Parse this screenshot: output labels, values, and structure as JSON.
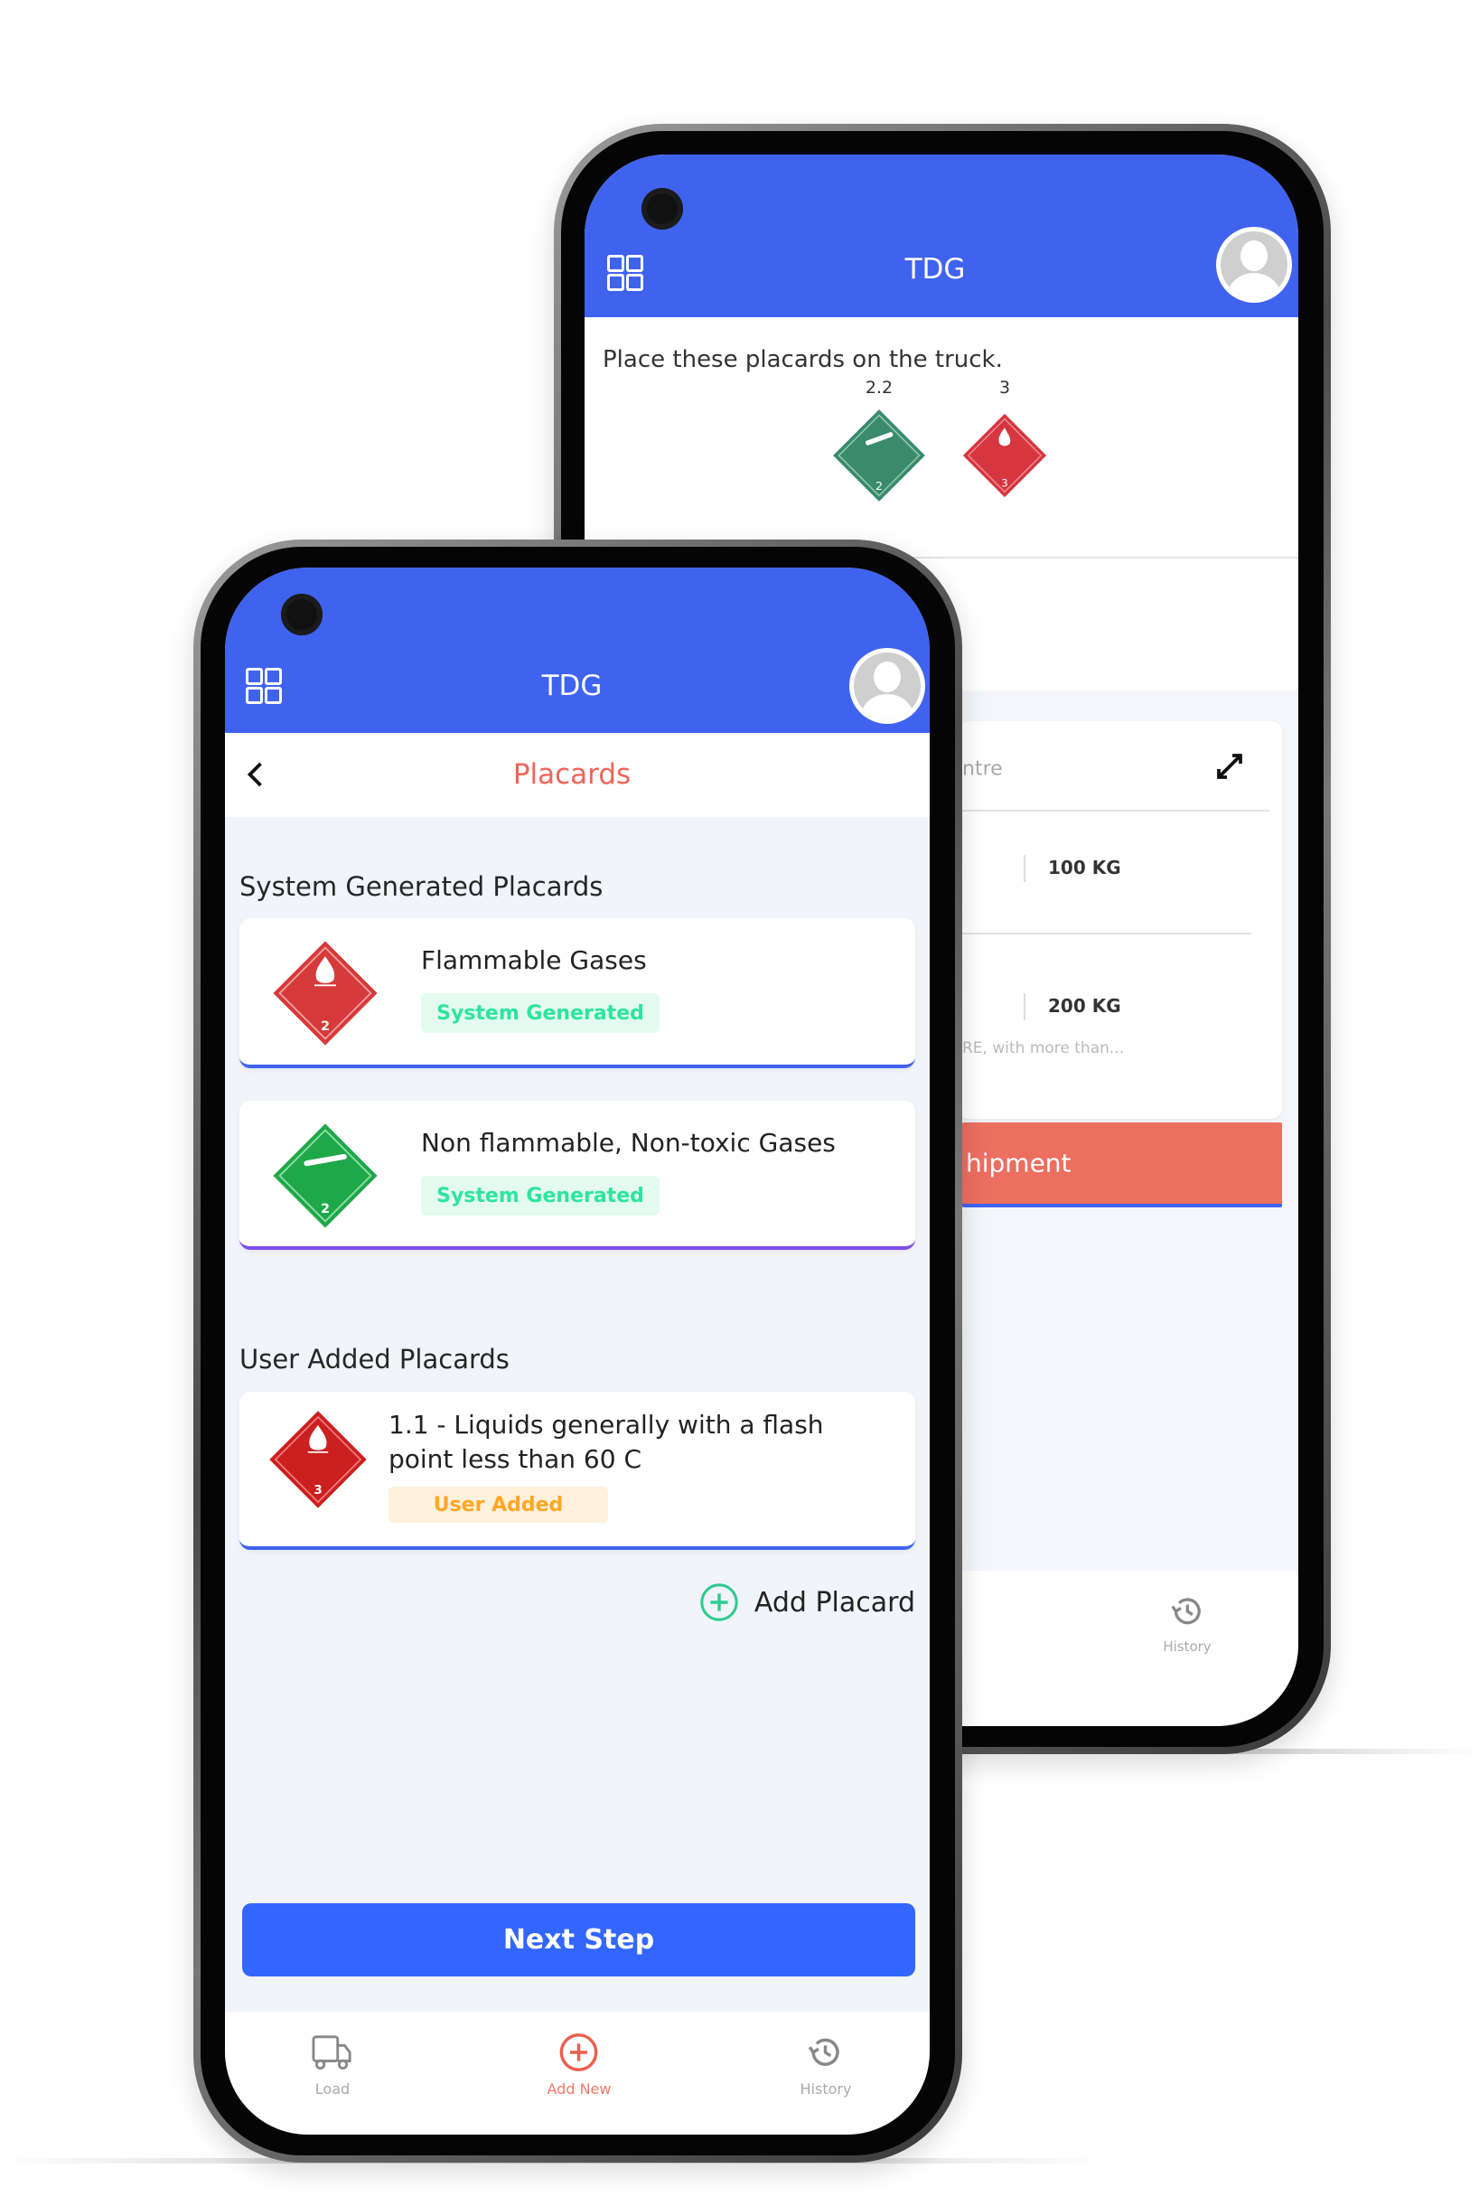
{
  "colors": {
    "header_blue": "#3f63ef",
    "accent_coral": "#f0645a",
    "button_blue": "#3366ff",
    "badge_green_text": "#2ee59d",
    "badge_green_bg": "#e3fbf1",
    "badge_orange_text": "#ffa726",
    "badge_orange_bg": "#fff1dc",
    "placard_red": "#d63a3a",
    "placard_green": "#1fa84a"
  },
  "back_phone": {
    "app_title": "TDG",
    "instruction": "Place these placards on the truck.",
    "placards": [
      {
        "label": "2.2",
        "class_number": "2",
        "color": "#3a8a6c",
        "icon": "gas-cylinder-icon"
      },
      {
        "label": "3",
        "class_number": "3",
        "color": "#d6363f",
        "icon": "flame-icon"
      }
    ],
    "card": {
      "field_fragment": "ntre",
      "weights": [
        "100 KG",
        "200 KG"
      ],
      "description_fragment": "RE, with more than...",
      "button_fragment": "hipment"
    },
    "nav": {
      "history_label": "History"
    }
  },
  "front_phone": {
    "app_title": "TDG",
    "page_title": "Placards",
    "system_section_title": "System Generated Placards",
    "system_placards": [
      {
        "title": "Flammable Gases",
        "badge": "System Generated",
        "class_number": "2",
        "color": "#d63a3a",
        "icon": "flame-icon",
        "accent": "#3f63ef"
      },
      {
        "title": "Non flammable, Non-toxic Gases",
        "badge": "System Generated",
        "class_number": "2",
        "color": "#1fa84a",
        "icon": "gas-cylinder-icon",
        "accent": "#7c4dea"
      }
    ],
    "user_section_title": "User Added Placards",
    "user_placards": [
      {
        "title_line1": "1.1 - Liquids generally with a flash",
        "title_line2": "point less than 60 C",
        "badge": "User Added",
        "class_number": "3",
        "color": "#cc1f1f",
        "icon": "flame-icon",
        "accent": "#3f63ef"
      }
    ],
    "add_placard_label": "Add Placard",
    "next_step_label": "Next Step",
    "nav": [
      {
        "label": "Load",
        "icon": "truck-icon",
        "active": false
      },
      {
        "label": "Add New",
        "icon": "plus-circle-icon",
        "active": true
      },
      {
        "label": "History",
        "icon": "history-icon",
        "active": false
      }
    ]
  }
}
